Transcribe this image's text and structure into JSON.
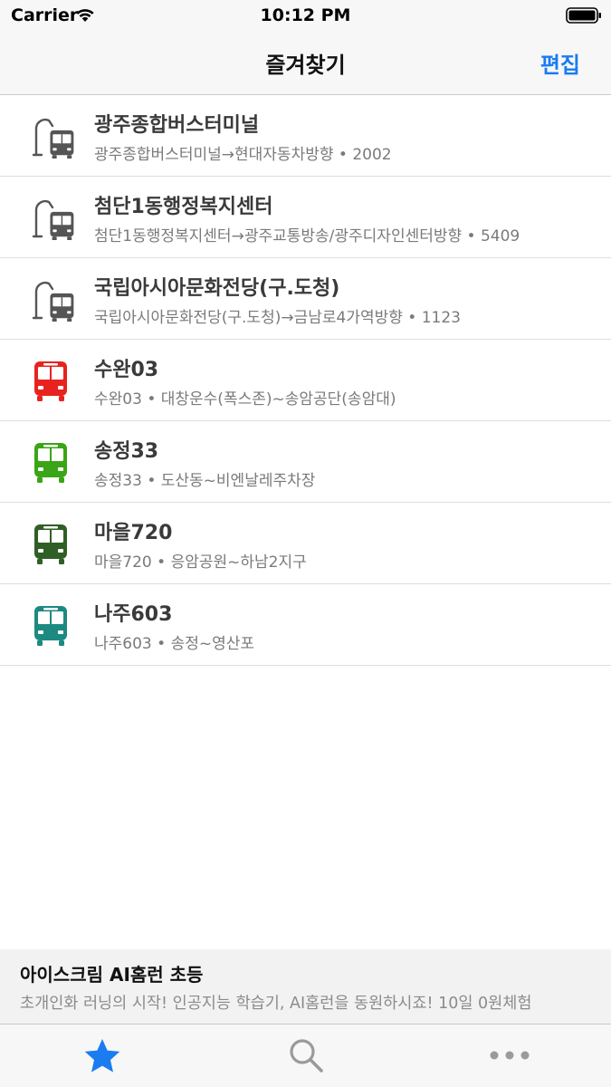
{
  "status_bar": {
    "carrier": "Carrier",
    "time": "10:12 PM"
  },
  "nav": {
    "title": "즐겨찾기",
    "edit_label": "편집"
  },
  "favorites": [
    {
      "kind": "stop",
      "icon": "bus-stop-icon",
      "color": "#555555",
      "title": "광주종합버스터미널",
      "subtitle": "광주종합버스터미널→현대자동차방향 • 2002"
    },
    {
      "kind": "stop",
      "icon": "bus-stop-icon",
      "color": "#555555",
      "title": "첨단1동행정복지센터",
      "subtitle": "첨단1동행정복지센터→광주교통방송/광주디자인센터방향 • 5409"
    },
    {
      "kind": "stop",
      "icon": "bus-stop-icon",
      "color": "#555555",
      "title": "국립아시아문화전당(구.도청)",
      "subtitle": "국립아시아문화전당(구.도청)→금남로4가역방향 • 1123"
    },
    {
      "kind": "route",
      "icon": "bus-icon",
      "color": "#e8231f",
      "title": "수완03",
      "subtitle": "수완03 • 대창운수(폭스존)~송암공단(송암대)"
    },
    {
      "kind": "route",
      "icon": "bus-icon",
      "color": "#3aa516",
      "title": "송정33",
      "subtitle": "송정33 • 도산동~비엔날레주차장"
    },
    {
      "kind": "route",
      "icon": "bus-icon",
      "color": "#2f5f25",
      "title": "마을720",
      "subtitle": "마을720 • 응암공원~하남2지구"
    },
    {
      "kind": "route",
      "icon": "bus-icon",
      "color": "#1c8a80",
      "title": "나주603",
      "subtitle": "나주603 • 송정~영산포"
    }
  ],
  "ad": {
    "title": "아이스크림 AI홈런 초등",
    "text": "초개인화 러닝의 시작! 인공지능 학습기, AI홈런을 동원하시죠! 10일 0원체험"
  },
  "tabs": [
    {
      "name": "favorites",
      "icon": "star-icon",
      "active": true,
      "color": "#1a7cf0"
    },
    {
      "name": "search",
      "icon": "search-icon",
      "active": false,
      "color": "#9a9a9a"
    },
    {
      "name": "more",
      "icon": "more-icon",
      "active": false,
      "color": "#9a9a9a"
    }
  ]
}
